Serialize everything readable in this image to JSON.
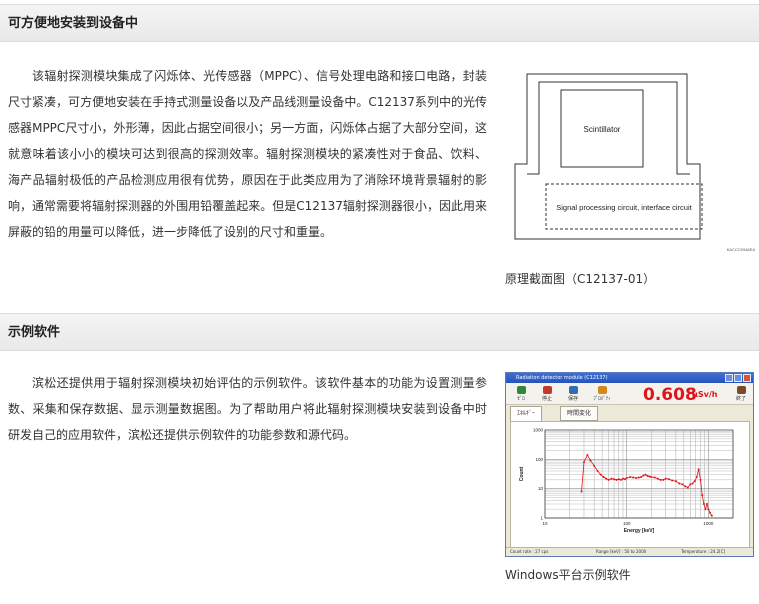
{
  "section1": {
    "title": "可方便地安装到设备中",
    "paragraph": "该辐射探测模块集成了闪烁体、光传感器（MPPC）、信号处理电路和接口电路，封装尺寸紧凑，可方便地安装在手持式测量设备以及产品线测量设备中。C12137系列中的光传感器MPPC尺寸小，外形薄，因此占据空间很小；另一方面，闪烁体占据了大部分空间，这就意味着该小小的模块可达到很高的探测效率。辐射探测模块的紧凑性对于食品、饮料、海产品辐射极低的产品检测应用很有优势，原因在于此类应用为了消除环境背景辐射的影响，通常需要将辐射探测器的外围用铅覆盖起来。但是C12137辐射探测器很小，因此用来屏蔽的铅的用量可以降低，进一步降低了设别的尺寸和重量。",
    "diagram": {
      "scintillator_label": "Scintillator",
      "circuit_label": "Signal processing circuit, interface circuit",
      "code": "KACCC0946EA"
    },
    "caption": "原理截面图（C12137-01）"
  },
  "section2": {
    "title": "示例软件",
    "paragraph": "滨松还提供用于辐射探测模块初始评估的示例软件。该软件基本的功能为设置测量参数、采集和保存数据、显示测量数据图。为了帮助用户将此辐射探测模块安装到设备中时研发自己的应用软件，滨松还提供示例软件的功能参数和源代码。",
    "caption": "Windows平台示例软件"
  },
  "app": {
    "window_title": "Radiation detector module (C12137)",
    "toolbar": [
      {
        "label": "ｾﾞﾛ",
        "icon": "start-icon",
        "color": "#2b8a3e"
      },
      {
        "label": "停止",
        "icon": "stop-icon",
        "color": "#c0392b"
      },
      {
        "label": "保存",
        "icon": "save-icon",
        "color": "#2f6fb0"
      },
      {
        "label": "ﾌﾟﾛﾊﾟﾃｨ",
        "icon": "property-icon",
        "color": "#d08a1c"
      }
    ],
    "dose_value": "0.608",
    "dose_unit": "μSv/h",
    "exit_label": "終了",
    "tabs": [
      {
        "label": "ｴﾈﾙｷﾞｰ"
      },
      {
        "label": "時間変化"
      }
    ],
    "status": [
      "Count rate : 27 cps",
      "Range [keV] : 50 to 2000",
      "Temperature : 24.2[C]"
    ]
  },
  "chart_data": {
    "type": "scatter",
    "title": "",
    "xlabel": "Energy [keV]",
    "ylabel": "Count",
    "xscale": "log",
    "yscale": "log",
    "xlim": [
      10,
      2000
    ],
    "ylim": [
      1,
      1000
    ],
    "x_ticks": [
      "10",
      "100",
      "1000"
    ],
    "y_ticks": [
      "1",
      "10",
      "100",
      "1000"
    ],
    "color": "#e0141b",
    "series": [
      {
        "x": [
          28,
          30,
          33,
          36,
          40,
          44,
          48,
          52,
          56,
          60,
          65,
          70,
          75,
          80,
          85,
          90,
          95,
          100,
          110,
          120,
          130,
          140,
          150,
          160,
          170,
          180,
          190,
          200,
          220,
          240,
          260,
          280,
          300,
          330,
          360,
          400,
          440,
          480,
          520,
          560,
          600,
          640,
          680,
          720,
          760,
          800,
          840,
          880,
          920,
          960,
          1000,
          1050,
          1100
        ],
        "y": [
          8,
          80,
          140,
          90,
          60,
          40,
          30,
          25,
          22,
          20,
          22,
          21,
          20,
          21,
          20,
          22,
          21,
          23,
          25,
          24,
          23,
          24,
          25,
          28,
          30,
          27,
          26,
          25,
          24,
          22,
          20,
          20,
          22,
          21,
          19,
          18,
          15,
          14,
          12,
          11,
          14,
          15,
          18,
          25,
          45,
          20,
          6,
          3,
          2,
          3,
          2,
          1.5,
          1.2
        ]
      }
    ]
  }
}
